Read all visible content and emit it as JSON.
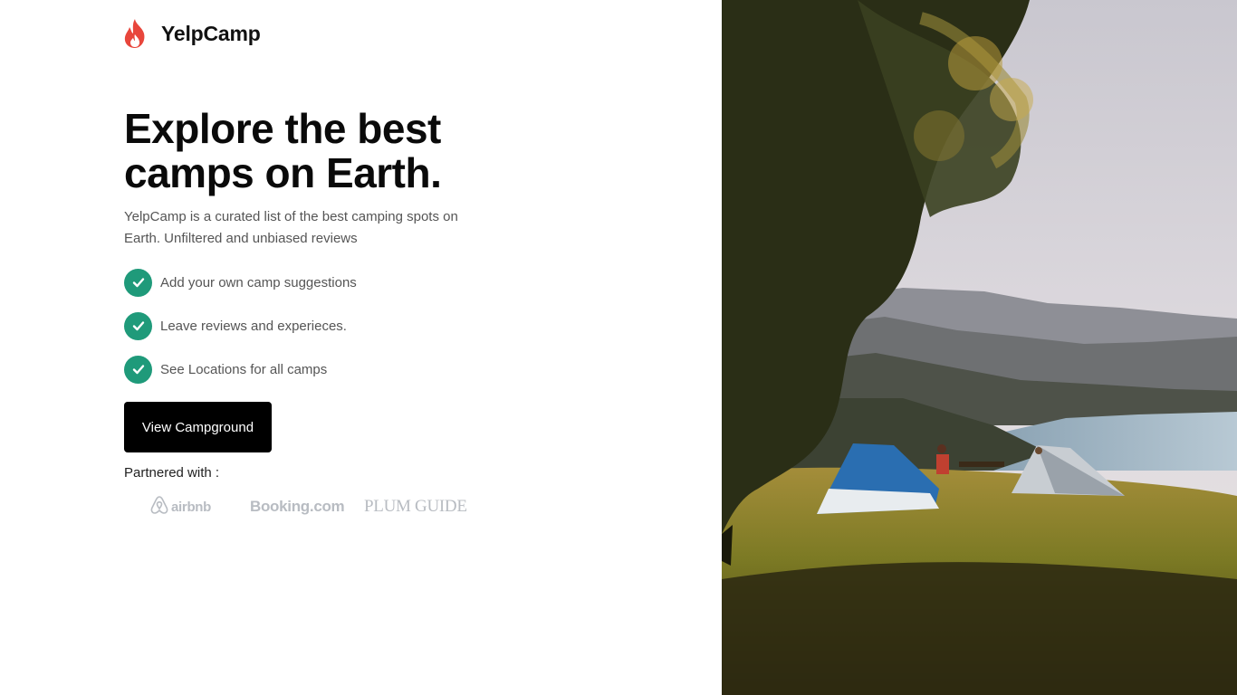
{
  "brand": {
    "name": "YelpCamp",
    "icon": "flame-icon",
    "accent": "#e8463c"
  },
  "hero": {
    "headline_line1": "Explore the best",
    "headline_line2": "camps on Earth.",
    "description": "YelpCamp is a curated list of the best camping spots on Earth. Unfiltered and unbiased reviews"
  },
  "features": [
    {
      "label": "Add your own camp suggestions",
      "icon": "check-circle-icon"
    },
    {
      "label": "Leave reviews and experieces.",
      "icon": "check-circle-icon"
    },
    {
      "label": "See Locations for all camps",
      "icon": "check-circle-icon"
    }
  ],
  "cta": {
    "label": "View Campground"
  },
  "partners": {
    "label": "Partnered with :",
    "logos": [
      "airbnb",
      "Booking.com",
      "PLUM GUIDE"
    ]
  },
  "colors": {
    "check": "#1f9a7a",
    "button": "#000000",
    "partner_logo": "#b8bcc2"
  }
}
